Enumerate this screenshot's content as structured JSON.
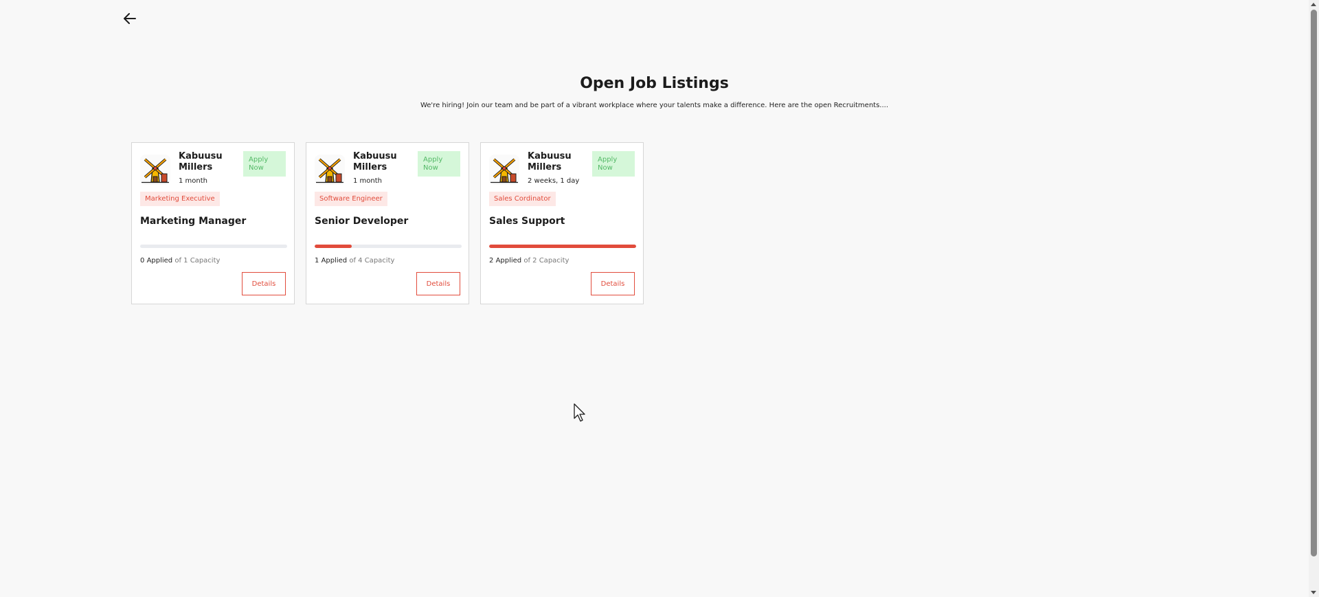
{
  "header": {
    "title": "Open Job Listings",
    "subtitle": "We're hiring! Join our team and be part of a vibrant workplace where your talents make a difference. Here are the open Recruitments...."
  },
  "icons": {
    "back": "arrow-left-icon",
    "logo": "windmill-icon"
  },
  "colors": {
    "accent": "#e14b3b",
    "apply_bg": "#d5f7d9",
    "apply_text": "#53b866",
    "tag_bg": "#fde8e6"
  },
  "jobs": [
    {
      "company": "Kabuusu Millers",
      "posted": "1 month",
      "apply_label": "Apply Now",
      "tag": "Marketing Executive",
      "title": "Marketing Manager",
      "applied_count": "0",
      "applied_label": "Applied",
      "capacity_text": "of 1 Capacity",
      "fill_fraction": 0,
      "details_label": "Details"
    },
    {
      "company": "Kabuusu Millers",
      "posted": "1 month",
      "apply_label": "Apply Now",
      "tag": "Software Engineer",
      "title": "Senior Developer",
      "applied_count": "1",
      "applied_label": "Applied",
      "capacity_text": "of 4 Capacity",
      "fill_fraction": 0.25,
      "details_label": "Details"
    },
    {
      "company": "Kabuusu Millers",
      "posted": "2 weeks, 1 day",
      "apply_label": "Apply Now",
      "tag": "Sales Cordinator",
      "title": "Sales Support",
      "applied_count": "2",
      "applied_label": "Applied",
      "capacity_text": "of 2 Capacity",
      "fill_fraction": 1,
      "details_label": "Details"
    }
  ]
}
